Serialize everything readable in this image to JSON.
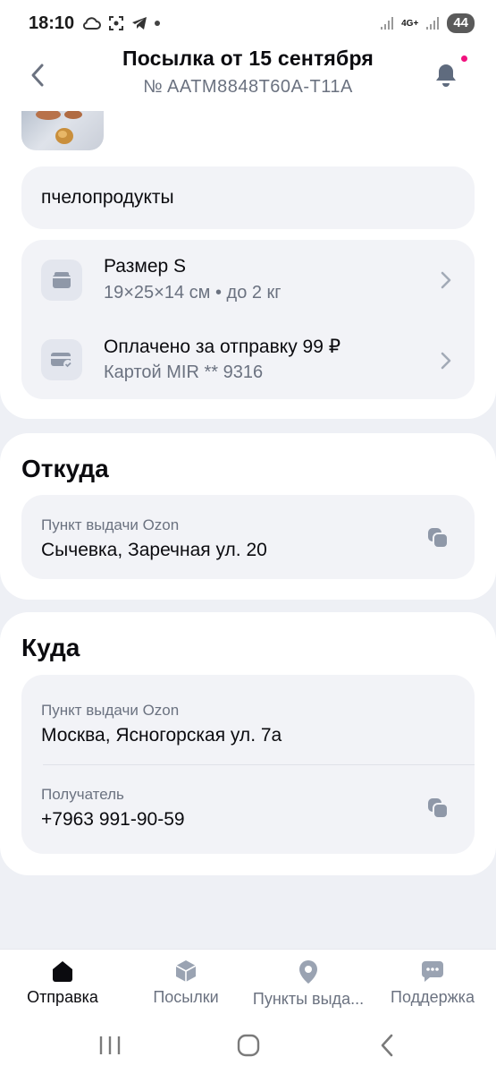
{
  "status_bar": {
    "time": "18:10",
    "network": "4G+",
    "battery": "44"
  },
  "header": {
    "title": "Посылка от 15 сентября",
    "subtitle": "№ AATM8848T60A-T11A"
  },
  "contents": {
    "description": "пчелопродукты"
  },
  "details": {
    "size": {
      "title": "Размер S",
      "subtitle": "19×25×14 см • до 2 кг",
      "icon": "box-icon"
    },
    "payment": {
      "title": "Оплачено за отправку 99 ₽",
      "subtitle": "Картой MIR ** 9316",
      "icon": "card-check-icon"
    }
  },
  "from": {
    "title": "Откуда",
    "label": "Пункт выдачи Ozon",
    "address": "Сычевка, Заречная ул. 20"
  },
  "to": {
    "title": "Куда",
    "label": "Пункт выдачи Ozon",
    "address": "Москва, Ясногорская ул. 7а",
    "recipient_label": "Получатель",
    "recipient_phone": "+7963 991-90-59"
  },
  "tabs": [
    {
      "label": "Отправка",
      "icon": "home-icon",
      "active": true
    },
    {
      "label": "Посылки",
      "icon": "parcel-icon",
      "active": false
    },
    {
      "label": "Пункты выда...",
      "icon": "location-pin-icon",
      "active": false
    },
    {
      "label": "Поддержка",
      "icon": "chat-icon",
      "active": false
    }
  ],
  "colors": {
    "accent_dot": "#f1117e",
    "icon_inactive": "#9aa3b2",
    "icon_active": "#0b0b0f",
    "text_secondary": "#6b7280"
  }
}
